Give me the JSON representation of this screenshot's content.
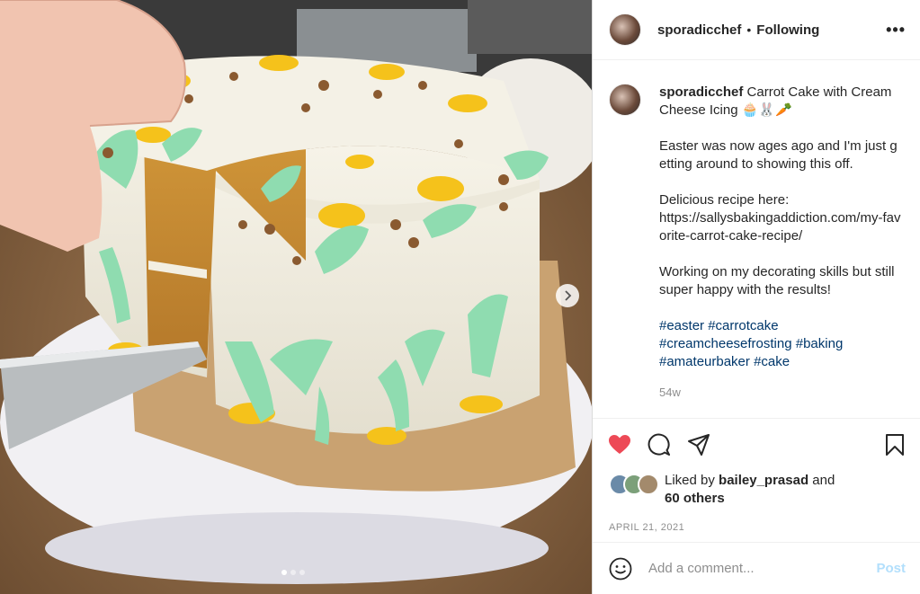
{
  "header": {
    "username": "sporadicchef",
    "separator": "•",
    "follow_status": "Following",
    "more": "•••"
  },
  "caption": {
    "username": "sporadicchef",
    "title": "Carrot Cake with Cream Cheese Icing 🧁🐰🥕",
    "para1": "Easter was now ages ago and I'm just getting around to showing this off.",
    "para2": "Delicious recipe here:\nhttps://sallysbakingaddiction.com/my-favorite-carrot-cake-recipe/",
    "para3": "Working on my decorating skills but still super happy with the results!",
    "hashtags": [
      "#easter",
      "#carrotcake",
      "#creamcheesefrosting",
      "#baking",
      "#amateurbaker",
      "#cake"
    ],
    "age": "54w"
  },
  "likes": {
    "prefix": "Liked by",
    "user": "bailey_prasad",
    "connector": "and",
    "others": "60 others"
  },
  "date": "APRIL 21, 2021",
  "comment": {
    "placeholder": "Add a comment...",
    "post_label": "Post"
  },
  "carousel": {
    "total": 3,
    "current": 1
  },
  "colors": {
    "like_red": "#ed4956",
    "link_blue": "#00376b",
    "post_disabled": "#b2dffc",
    "frosting_green": "#8fdcb0",
    "frosting_yellow": "#f5c21b"
  },
  "icons": {
    "like": "heart-filled-icon",
    "comment": "comment-bubble-icon",
    "share": "paper-plane-icon",
    "save": "bookmark-icon",
    "emoji": "smiley-icon",
    "next": "chevron-right-icon"
  }
}
